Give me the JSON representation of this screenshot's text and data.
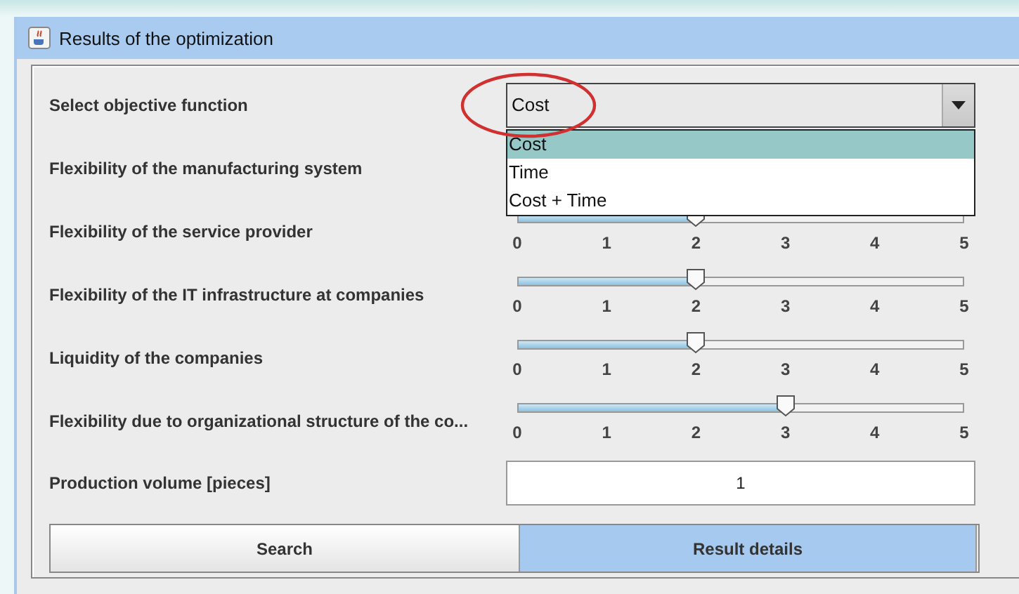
{
  "window": {
    "title": "Results of the optimization"
  },
  "objective": {
    "label": "Select objective function",
    "value": "Cost",
    "expanded": true,
    "options": [
      {
        "label": "Cost",
        "selected": true
      },
      {
        "label": "Time",
        "selected": false
      },
      {
        "label": "Cost + Time",
        "selected": false
      }
    ]
  },
  "sliders": [
    {
      "label": "Flexibility of the manufacturing system"
    },
    {
      "label": "Flexibility of the service provider",
      "level": 0.4,
      "ticks": [
        "0",
        "1",
        "2",
        "3",
        "4",
        "5"
      ]
    },
    {
      "label": "Flexibility of the IT infrastructure at companies",
      "level": 0.4,
      "ticks": [
        "0",
        "1",
        "2",
        "3",
        "4",
        "5"
      ]
    },
    {
      "label": "Liquidity of the companies",
      "level": 0.4,
      "ticks": [
        "0",
        "1",
        "2",
        "3",
        "4",
        "5"
      ]
    },
    {
      "label": "Flexibility due to organizational structure of the co...",
      "level": 0.6,
      "ticks": [
        "0",
        "1",
        "2",
        "3",
        "4",
        "5"
      ]
    }
  ],
  "production": {
    "label": "Production volume [pieces]",
    "value": "1"
  },
  "buttons": [
    {
      "label": "Search",
      "selected": false
    },
    {
      "label": "Result details",
      "selected": true
    }
  ]
}
